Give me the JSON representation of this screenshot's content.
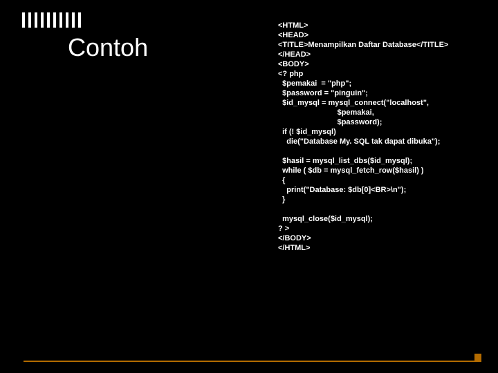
{
  "slide": {
    "title": "Contoh"
  },
  "code": {
    "l01": "<HTML>",
    "l02": "<HEAD>",
    "l03": "<TITLE>Menampilkan Daftar Database</TITLE>",
    "l04": "</HEAD>",
    "l05": "<BODY>",
    "l06": "<? php",
    "l07": "  $pemakai  = \"php\";",
    "l08": "  $password = \"pinguin\";",
    "l09": "  $id_mysql = mysql_connect(\"localhost\",",
    "l10": "                            $pemakai,",
    "l11": "                            $password);",
    "l12": "  if (! $id_mysql)",
    "l13": "    die(\"Database My. SQL tak dapat dibuka\");",
    "l14": "",
    "l15": "  $hasil = mysql_list_dbs($id_mysql);",
    "l16": "  while ( $db = mysql_fetch_row($hasil) )",
    "l17": "  {",
    "l18": "    print(\"Database: $db[0]<BR>\\n\");",
    "l19": "  }",
    "l20": "",
    "l21": "  mysql_close($id_mysql);",
    "l22": "? >",
    "l23": "</BODY>",
    "l24": "</HTML>"
  }
}
